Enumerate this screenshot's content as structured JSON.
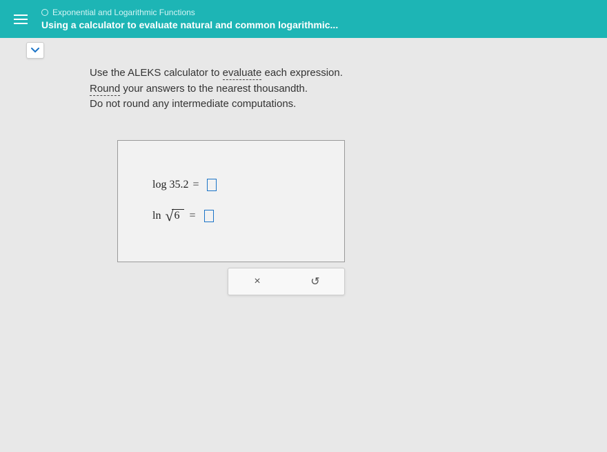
{
  "header": {
    "breadcrumb": "Exponential and Logarithmic Functions",
    "title": "Using a calculator to evaluate natural and common logarithmic..."
  },
  "instructions": {
    "line1_pre": "Use the ALEKS calculator to ",
    "line1_underlined": "evaluate",
    "line1_post": " each expression.",
    "line2_underlined": "Round",
    "line2_post": " your answers to the nearest thousandth.",
    "line3": "Do not round any intermediate computations."
  },
  "problems": {
    "p1": {
      "func": "log",
      "arg": "35.2",
      "equals": "="
    },
    "p2": {
      "func": "ln",
      "sqrt_arg": "6",
      "equals": "="
    }
  },
  "actions": {
    "clear": "×",
    "reset": "↺"
  }
}
